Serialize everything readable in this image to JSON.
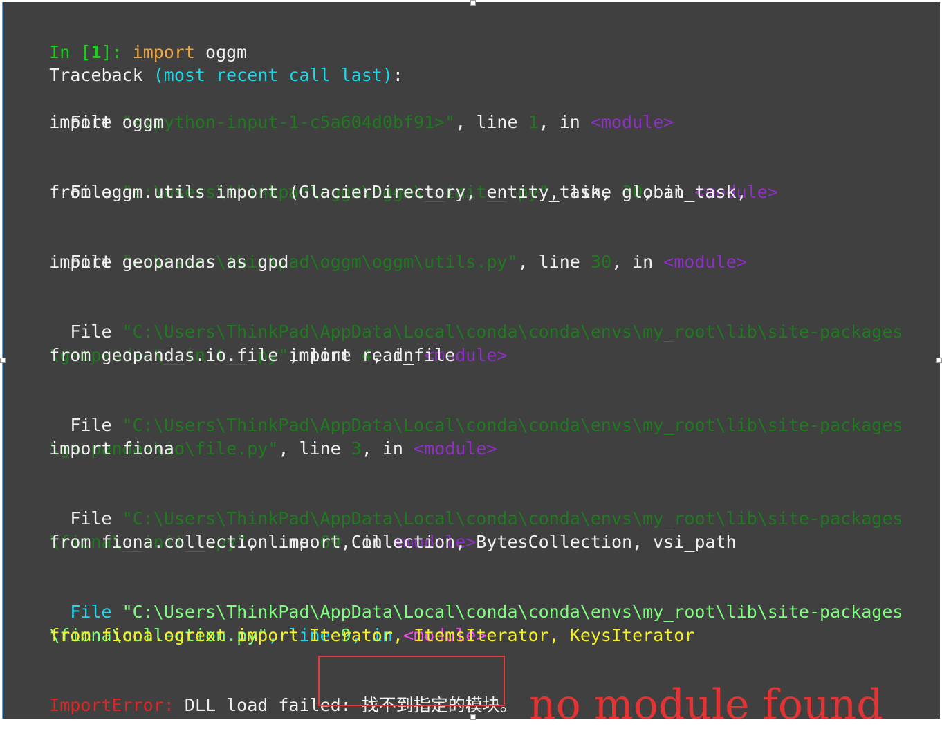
{
  "console": {
    "prompt": {
      "in_label": "In [",
      "number": "1",
      "close": "]: ",
      "keyword": "import",
      "module": " oggm"
    },
    "traceback_header": {
      "word": "Traceback ",
      "paren": "(most recent call last)",
      "colon": ":"
    },
    "frames": [
      {
        "lead": "  File ",
        "path_line1": "\"<ipython-input-1-c5a604d0bf91>\"",
        "path_line2": "",
        "line_word": ", line ",
        "line_no": "1",
        "in_word": ", in ",
        "module": "<module>",
        "code": "    import oggm"
      },
      {
        "lead": "  File ",
        "path_line1": "\"c:\\users\\thinkpad\\oggm\\oggm\\__init__.py\"",
        "path_line2": "",
        "line_word": ", line ",
        "line_no": "30",
        "in_word": ", in ",
        "module": "<module>",
        "code": "    from oggm.utils import (GlacierDirectory, entity_task, global_task,"
      },
      {
        "lead": "  File ",
        "path_line1": "\"c:\\users\\thinkpad\\oggm\\oggm\\utils.py\"",
        "path_line2": "",
        "line_word": ", line ",
        "line_no": "30",
        "in_word": ", in ",
        "module": "<module>",
        "code": "    import geopandas as gpd"
      },
      {
        "lead": "  File ",
        "path_line1": "\"C:\\Users\\ThinkPad\\AppData\\Local\\conda\\conda\\envs\\my_root\\lib\\site-packages",
        "path_line2": "\\geopandas\\__init__.py\"",
        "line_word": ", line ",
        "line_no": "4",
        "in_word": ", in ",
        "module": "<module>",
        "code": "    from geopandas.io.file import read_file"
      },
      {
        "lead": "  File ",
        "path_line1": "\"C:\\Users\\ThinkPad\\AppData\\Local\\conda\\conda\\envs\\my_root\\lib\\site-packages",
        "path_line2": "\\geopandas\\io\\file.py\"",
        "line_word": ", line ",
        "line_no": "3",
        "in_word": ", in ",
        "module": "<module>",
        "code": "    import fiona"
      },
      {
        "lead": "  File ",
        "path_line1": "\"C:\\Users\\ThinkPad\\AppData\\Local\\conda\\conda\\envs\\my_root\\lib\\site-packages",
        "path_line2": "\\fiona\\__init__.py\"",
        "line_word": ", line ",
        "line_no": "69",
        "in_word": ", in ",
        "module": "<module>",
        "code": "    from fiona.collection import Collection, BytesCollection, vsi_path"
      }
    ],
    "last_frame": {
      "lead": "  File ",
      "path_line1": "\"C:\\Users\\ThinkPad\\AppData\\Local\\conda\\conda\\envs\\my_root\\lib\\site-packages",
      "path_line2": "\\fiona\\collection.py\"",
      "line_word": ", line ",
      "line_no": "9",
      "in_word": ", in ",
      "module": "<module>",
      "code": "    from fiona.ogrext import Iterator, ItemsIterator, KeysIterator"
    },
    "error": {
      "type": "ImportError",
      "colon": ": ",
      "message": "DLL load failed: 找不到指定的模块。"
    }
  },
  "annotation": {
    "text": "no module found"
  },
  "colors": {
    "background": "#404040",
    "annotation_red": "#e23434",
    "prompt_green": "#16d316",
    "keyword_orange": "#f0a53d",
    "traceback_cyan": "#1ad8e8",
    "path_dark_green": "#1f7a1f",
    "module_purple": "#8e2fc4",
    "last_frame_yellow": "#f3ef2a",
    "error_red": "#e02424"
  }
}
